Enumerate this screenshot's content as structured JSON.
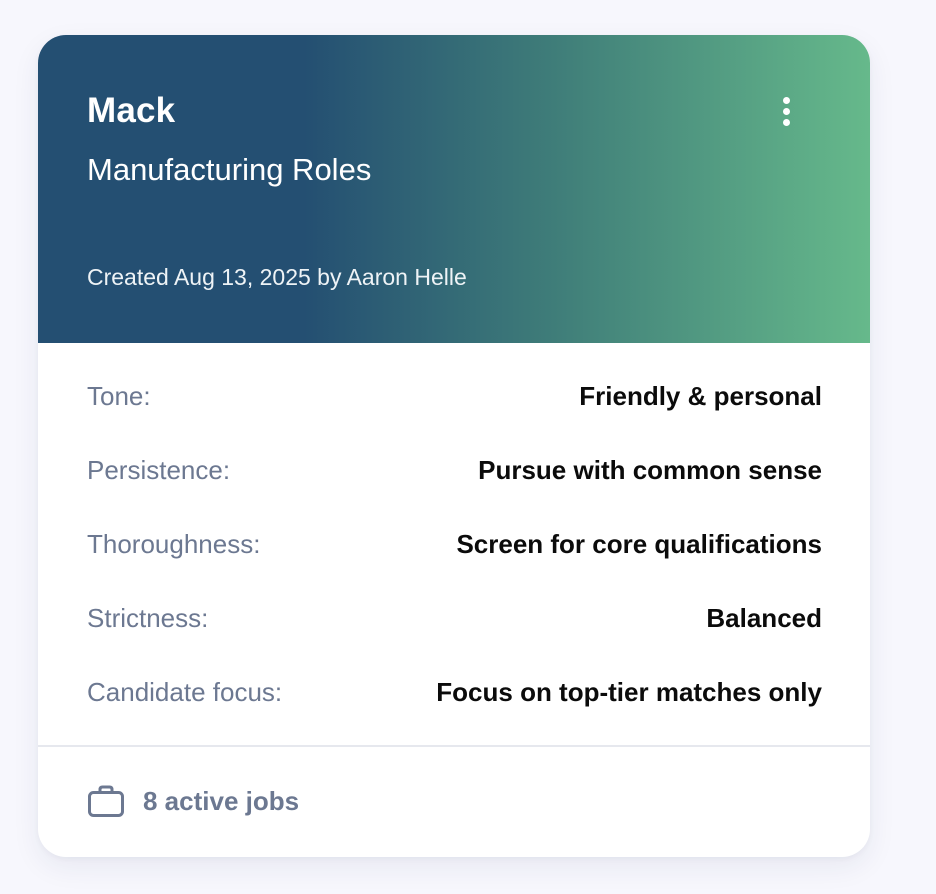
{
  "card": {
    "name": "Mack",
    "subtitle": "Manufacturing Roles",
    "created": "Created Aug 13, 2025 by Aaron Helle",
    "menu_icon": "kebab-menu-icon",
    "header_gradient": [
      "#244f72",
      "#3f7d79",
      "#66b98b"
    ]
  },
  "settings": [
    {
      "label": "Tone:",
      "value": "Friendly & personal"
    },
    {
      "label": "Persistence:",
      "value": "Pursue with common sense"
    },
    {
      "label": "Thoroughness:",
      "value": "Screen for core qualifications"
    },
    {
      "label": "Strictness:",
      "value": "Balanced"
    },
    {
      "label": "Candidate focus:",
      "value": "Focus on top-tier matches only"
    }
  ],
  "footer": {
    "icon": "briefcase-icon",
    "active_jobs": "8 active jobs"
  }
}
